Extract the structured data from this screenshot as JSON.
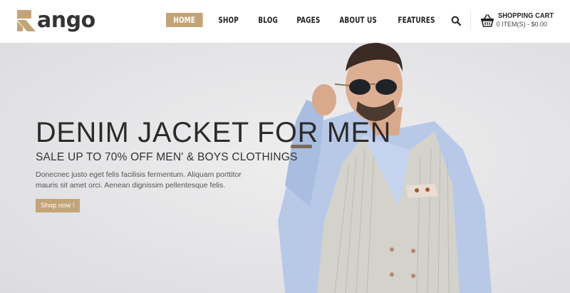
{
  "brand": {
    "name": "ango",
    "accent": "#c2a477"
  },
  "nav": {
    "items": [
      {
        "label": "HOME",
        "active": true
      },
      {
        "label": "SHOP",
        "active": false
      },
      {
        "label": "BLOG",
        "active": false
      },
      {
        "label": "PAGES",
        "active": false
      },
      {
        "label": "ABOUT US",
        "active": false
      },
      {
        "label": "FEATURES",
        "active": false
      }
    ]
  },
  "cart": {
    "title": "SHOPPING CART",
    "summary": "0 ITEM(S) - $0.00"
  },
  "hero": {
    "title": "DENIM JACKET FOR MEN",
    "subtitle": "SALE UP TO 70% OFF MEN' & BOYS CLOTHINGS",
    "description": "Donecnec justo eget felis facilisis fermentum. Aliquam porttitor mauris sit amet orci. Aenean dignissim pellentesque felis.",
    "button_label": "Shop now !"
  },
  "icons": {
    "search": "search-icon",
    "cart": "basket-icon",
    "logo": "logo-r-mark"
  }
}
